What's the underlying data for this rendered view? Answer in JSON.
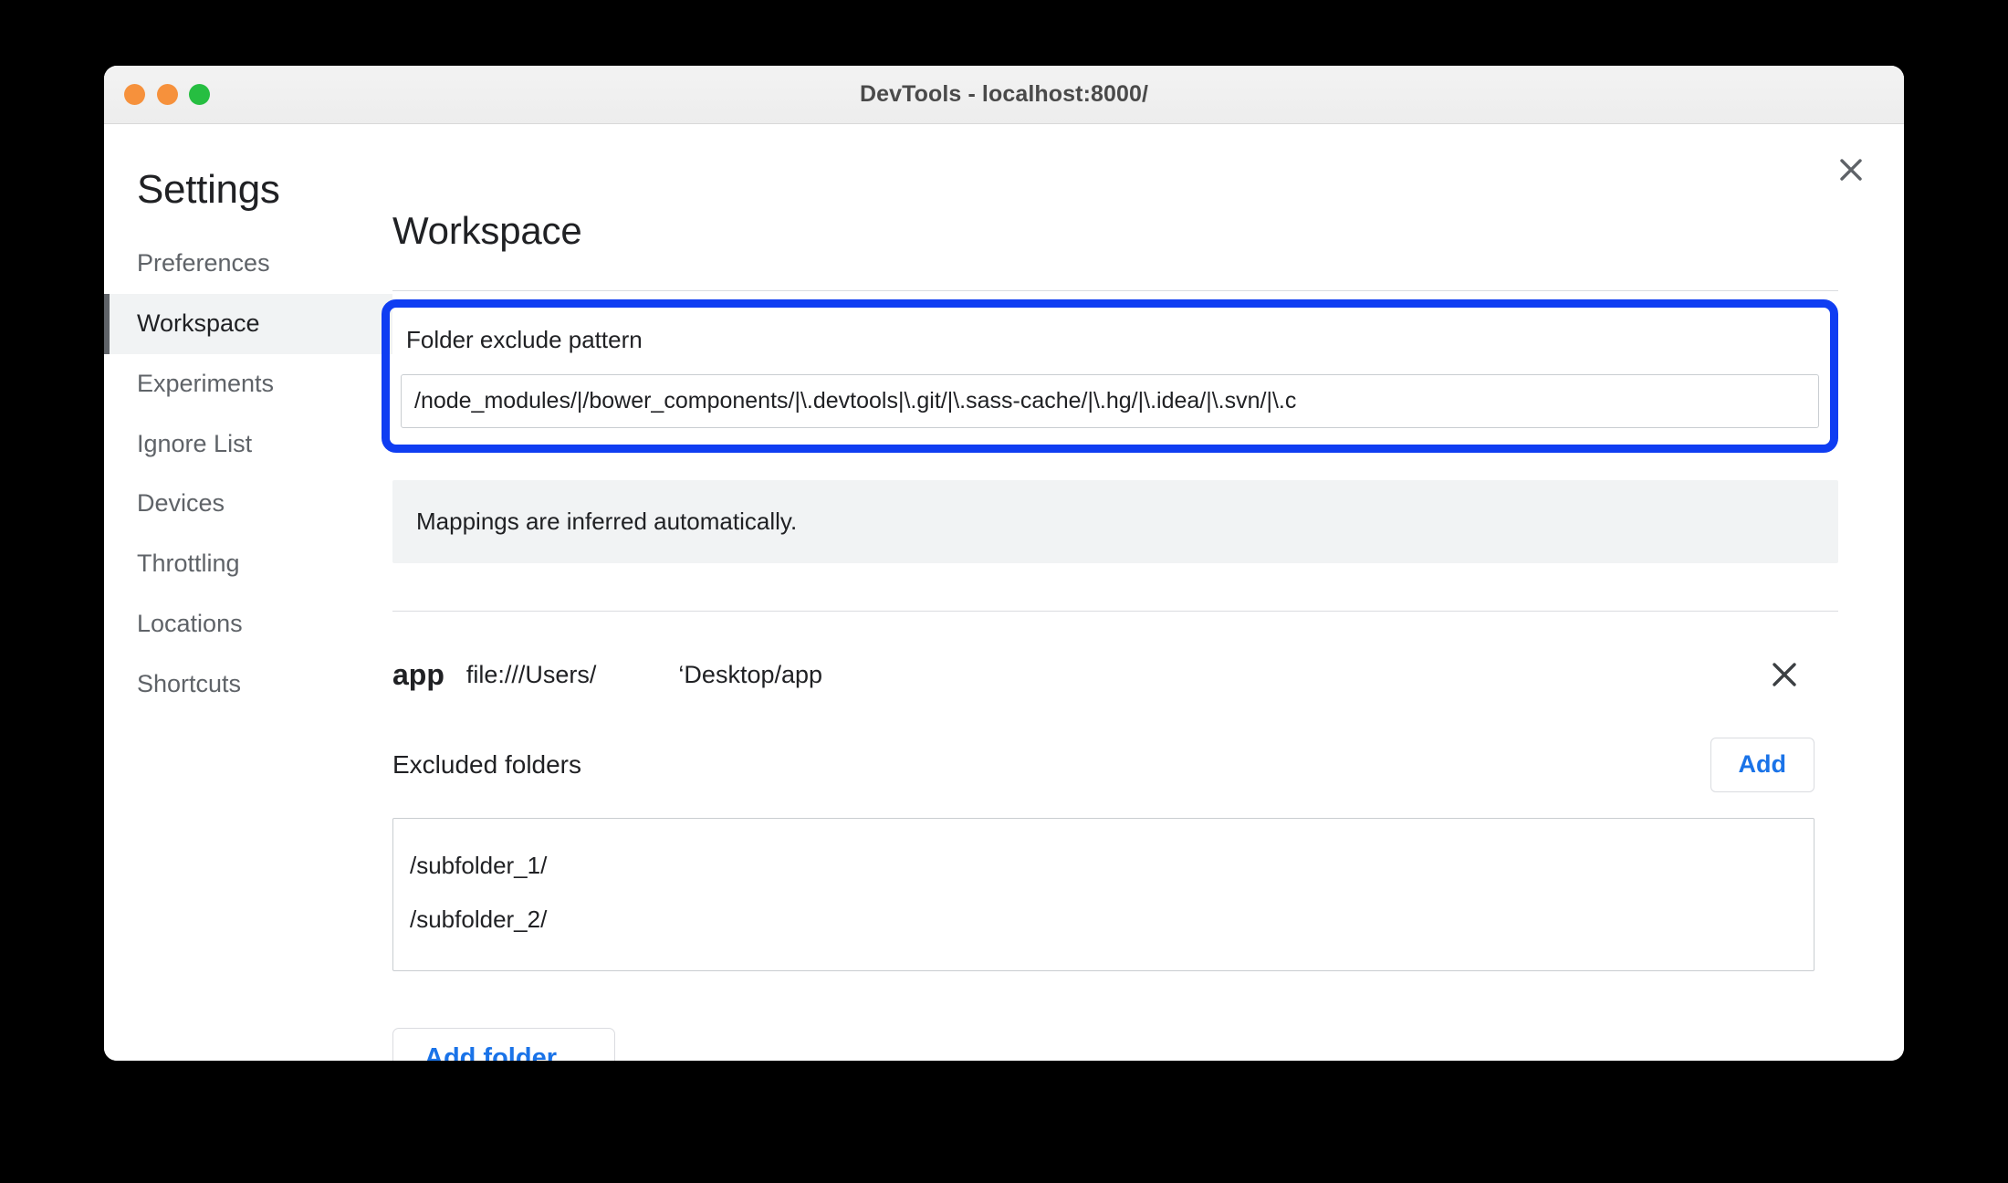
{
  "window": {
    "title": "DevTools - localhost:8000/",
    "traffic_lights": [
      {
        "name": "close",
        "color": "#f6913c"
      },
      {
        "name": "minimize",
        "color": "#f6913c"
      },
      {
        "name": "zoom",
        "color": "#26be41"
      }
    ]
  },
  "dialog": {
    "close_icon": "close-icon"
  },
  "sidebar": {
    "title": "Settings",
    "items": [
      {
        "label": "Preferences",
        "selected": false
      },
      {
        "label": "Workspace",
        "selected": true
      },
      {
        "label": "Experiments",
        "selected": false
      },
      {
        "label": "Ignore List",
        "selected": false
      },
      {
        "label": "Devices",
        "selected": false
      },
      {
        "label": "Throttling",
        "selected": false
      },
      {
        "label": "Locations",
        "selected": false
      },
      {
        "label": "Shortcuts",
        "selected": false
      }
    ]
  },
  "main": {
    "page_title": "Workspace",
    "exclude_pattern": {
      "label": "Folder exclude pattern",
      "value": "/node_modules/|/bower_components/|\\.devtools|\\.git/|\\.sass-cache/|\\.hg/|\\.idea/|\\.svn/|\\.c",
      "highlight_color": "#0f3df2"
    },
    "info_banner": "Mappings are inferred automatically.",
    "folder": {
      "name": "app",
      "path": "file:///Users/            ‘Desktop/app",
      "remove_icon": "close-icon"
    },
    "excluded_folders": {
      "title": "Excluded folders",
      "add_label": "Add",
      "items": [
        "/subfolder_1/",
        "/subfolder_2/"
      ]
    },
    "add_folder_label": "Add folder…"
  },
  "colors": {
    "accent_blue": "#1a73e8",
    "highlight_blue": "#0f3df2",
    "selected_bg": "#f1f3f4",
    "text_primary": "#202124",
    "text_secondary": "#5f6368"
  }
}
